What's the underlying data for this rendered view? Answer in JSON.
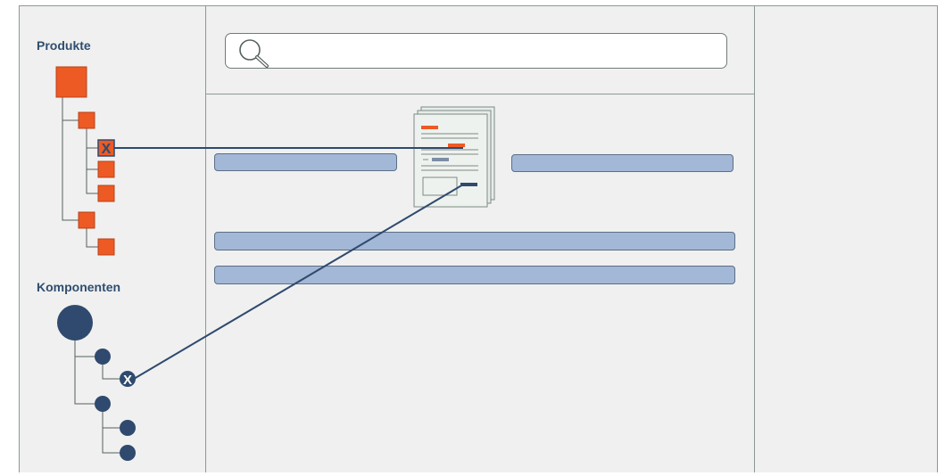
{
  "sidebar": {
    "products_label": "Produkte",
    "components_label": "Komponenten",
    "selected_marker": "X"
  },
  "colors": {
    "product_node": "#ee5a24",
    "component_node": "#2f4a6e",
    "link_line": "#2f4a6e",
    "field": "#a3b7d6"
  },
  "icons": [
    "search-icon",
    "document-stack-icon"
  ]
}
